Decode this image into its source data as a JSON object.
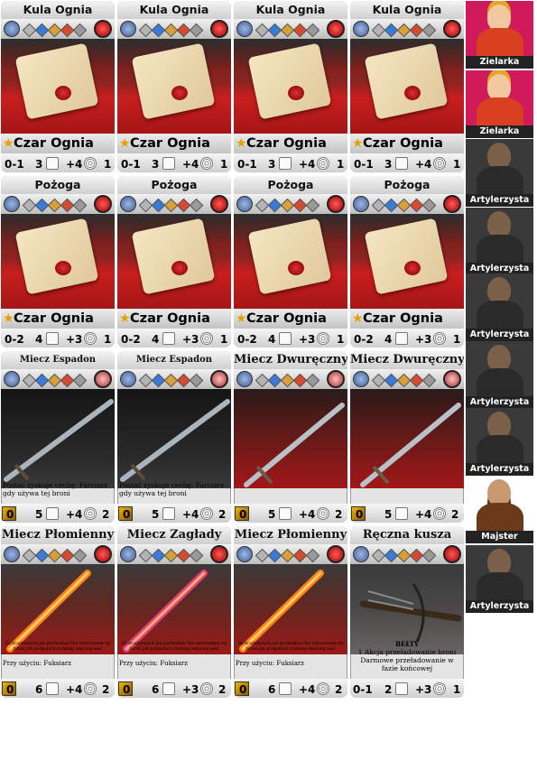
{
  "cards": [
    {
      "title": "Kula Ognia",
      "spell": "Czar Ognia",
      "stats": [
        "0-1",
        "3",
        "+4",
        "1"
      ],
      "art": "scroll"
    },
    {
      "title": "Kula Ognia",
      "spell": "Czar Ognia",
      "stats": [
        "0-1",
        "3",
        "+4",
        "1"
      ],
      "art": "scroll"
    },
    {
      "title": "Kula Ognia",
      "spell": "Czar Ognia",
      "stats": [
        "0-1",
        "3",
        "+4",
        "1"
      ],
      "art": "scroll"
    },
    {
      "title": "Kula Ognia",
      "spell": "Czar Ognia",
      "stats": [
        "0-1",
        "3",
        "+4",
        "1"
      ],
      "art": "scroll"
    },
    {
      "title": "Pożoga",
      "spell": "Czar Ognia",
      "stats": [
        "0-2",
        "4",
        "+3",
        "1"
      ],
      "art": "scroll"
    },
    {
      "title": "Pożoga",
      "spell": "Czar Ognia",
      "stats": [
        "0-2",
        "4",
        "+3",
        "1"
      ],
      "art": "scroll"
    },
    {
      "title": "Pożoga",
      "spell": "Czar Ognia",
      "stats": [
        "0-2",
        "4",
        "+3",
        "1"
      ],
      "art": "scroll"
    },
    {
      "title": "Pożoga",
      "spell": "Czar Ognia",
      "stats": [
        "0-2",
        "4",
        "+3",
        "1"
      ],
      "art": "scroll"
    },
    {
      "title": "Miecz Espadon",
      "desc": "Postać zyskuje cechę: Farciarz gdy używa tej broni",
      "stats": [
        "0",
        "5",
        "+4",
        "2"
      ],
      "art": "sword"
    },
    {
      "title": "Miecz Espadon",
      "desc": "Postać zyskuje cechę: Farciarz gdy używa tej broni",
      "stats": [
        "0",
        "5",
        "+4",
        "2"
      ],
      "art": "sword"
    },
    {
      "title": "Miecz Dwuręczny",
      "stats": [
        "0",
        "5",
        "+4",
        "2"
      ],
      "art": "swordred"
    },
    {
      "title": "Miecz Dwuręczny",
      "stats": [
        "0",
        "5",
        "+4",
        "2"
      ],
      "art": "swordred"
    },
    {
      "title": "Miecz Płomienny",
      "desc": "Za kradzieżach jak pochodnia Nie używaszem tej broni jak podpalacz rozlanej smoczej sieć",
      "use": "Przy użyciu: Fuksiarz",
      "stats": [
        "0",
        "6",
        "+4",
        "2"
      ],
      "art": "fire"
    },
    {
      "title": "Miecz Zagłady",
      "desc": "Za kradzieżach jak pochodnia Nie używaszem tej broni jak podpalacz rozlanej smoczej sieć",
      "use": "Przy użyciu: Fuksiarz",
      "stats": [
        "0",
        "6",
        "+3",
        "2"
      ],
      "art": "fire"
    },
    {
      "title": "Miecz Płomienny",
      "desc": "Za kradzieżach jak pochodnia Nie używaszem tej broni jak podpalacz rozlanej smoczej sieć",
      "use": "Przy użyciu: Fuksiarz",
      "stats": [
        "0",
        "6",
        "+4",
        "2"
      ],
      "art": "fire"
    },
    {
      "title": "Ręczna kusza",
      "desc_title": "BEŁTY",
      "desc": "1 Akcja przeładowanie broni Darmowe przeładowanie w fazie końcowej",
      "stats": [
        "0-1",
        "2",
        "+3",
        "1"
      ],
      "art": "xbow"
    }
  ],
  "portraits": [
    {
      "label": "Zielarka",
      "type": "herbalist"
    },
    {
      "label": "Zielarka",
      "type": "herbalist"
    },
    {
      "label": "Artylerzysta",
      "type": "gunner"
    },
    {
      "label": "Artylerzysta",
      "type": "gunner"
    },
    {
      "label": "Artylerzysta",
      "type": "gunner"
    },
    {
      "label": "Artylerzysta",
      "type": "gunner"
    },
    {
      "label": "Artylerzysta",
      "type": "gunner"
    },
    {
      "label": "Majster",
      "type": "master"
    },
    {
      "label": "Artylerzysta",
      "type": "gunner"
    }
  ],
  "colors": {
    "fire_red": "#c91e1e",
    "gold": "#e6a000",
    "dark_bg": "#2b2a2a"
  }
}
